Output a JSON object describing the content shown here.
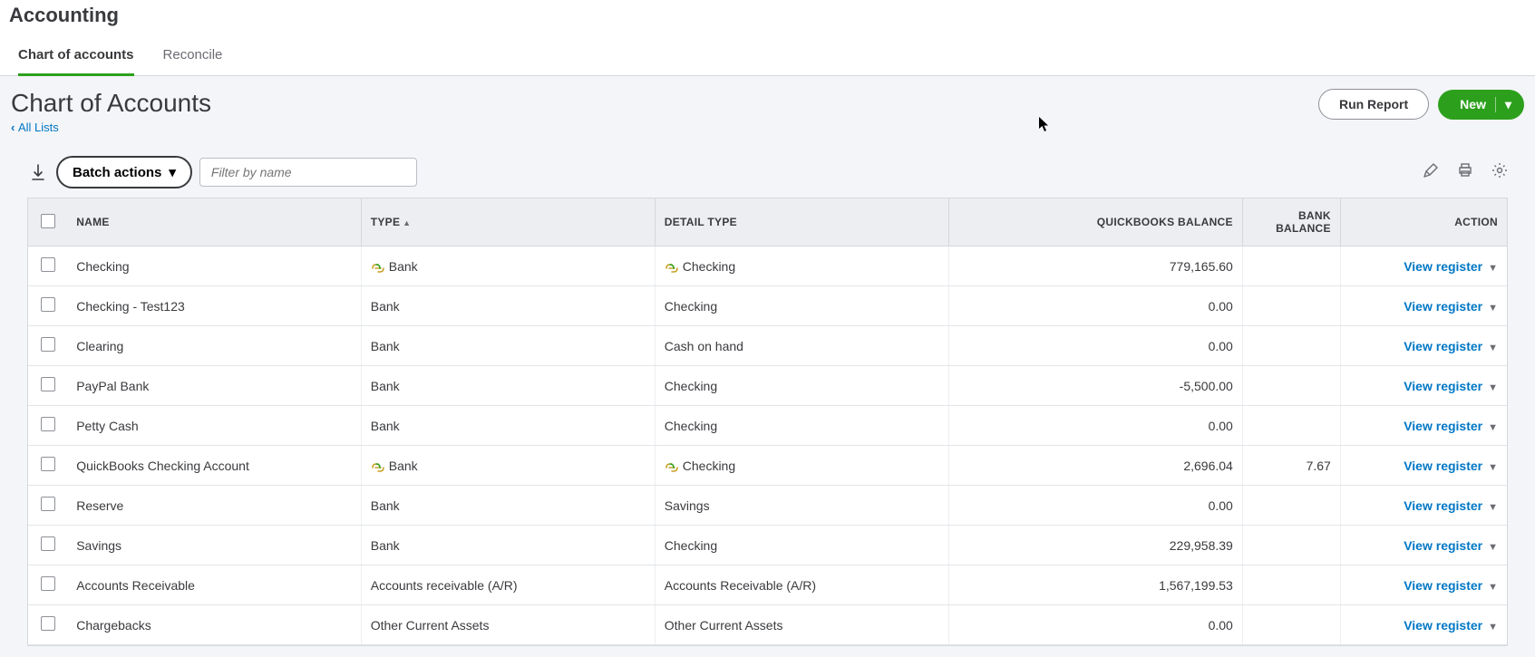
{
  "header": {
    "app_title": "Accounting",
    "tabs": [
      {
        "label": "Chart of accounts",
        "active": true
      },
      {
        "label": "Reconcile",
        "active": false
      }
    ]
  },
  "page": {
    "title": "Chart of Accounts",
    "back_link": "All Lists",
    "run_report_label": "Run Report",
    "new_label": "New"
  },
  "toolbar": {
    "batch_label": "Batch actions",
    "filter_placeholder": "Filter by name"
  },
  "icons": {
    "pencil": "pencil-icon",
    "print": "print-icon",
    "gear": "gear-icon",
    "collapse": "collapse-icon"
  },
  "table": {
    "columns": {
      "name": "NAME",
      "type": "TYPE",
      "detail": "DETAIL TYPE",
      "qb_balance": "QUICKBOOKS BALANCE",
      "bank_balance": "BANK BALANCE",
      "action": "ACTION"
    },
    "action_label": "View register",
    "rows": [
      {
        "name": "Checking",
        "type": "Bank",
        "type_linked": true,
        "detail": "Checking",
        "detail_linked": true,
        "qb": "779,165.60",
        "bank": ""
      },
      {
        "name": "Checking - Test123",
        "type": "Bank",
        "type_linked": false,
        "detail": "Checking",
        "detail_linked": false,
        "qb": "0.00",
        "bank": ""
      },
      {
        "name": "Clearing",
        "type": "Bank",
        "type_linked": false,
        "detail": "Cash on hand",
        "detail_linked": false,
        "qb": "0.00",
        "bank": ""
      },
      {
        "name": "PayPal Bank",
        "type": "Bank",
        "type_linked": false,
        "detail": "Checking",
        "detail_linked": false,
        "qb": "-5,500.00",
        "bank": ""
      },
      {
        "name": "Petty Cash",
        "type": "Bank",
        "type_linked": false,
        "detail": "Checking",
        "detail_linked": false,
        "qb": "0.00",
        "bank": ""
      },
      {
        "name": "QuickBooks Checking Account",
        "type": "Bank",
        "type_linked": true,
        "detail": "Checking",
        "detail_linked": true,
        "qb": "2,696.04",
        "bank": "7.67"
      },
      {
        "name": "Reserve",
        "type": "Bank",
        "type_linked": false,
        "detail": "Savings",
        "detail_linked": false,
        "qb": "0.00",
        "bank": ""
      },
      {
        "name": "Savings",
        "type": "Bank",
        "type_linked": false,
        "detail": "Checking",
        "detail_linked": false,
        "qb": "229,958.39",
        "bank": ""
      },
      {
        "name": "Accounts Receivable",
        "type": "Accounts receivable (A/R)",
        "type_linked": false,
        "detail": "Accounts Receivable (A/R)",
        "detail_linked": false,
        "qb": "1,567,199.53",
        "bank": ""
      },
      {
        "name": "Chargebacks",
        "type": "Other Current Assets",
        "type_linked": false,
        "detail": "Other Current Assets",
        "detail_linked": false,
        "qb": "0.00",
        "bank": ""
      }
    ]
  }
}
